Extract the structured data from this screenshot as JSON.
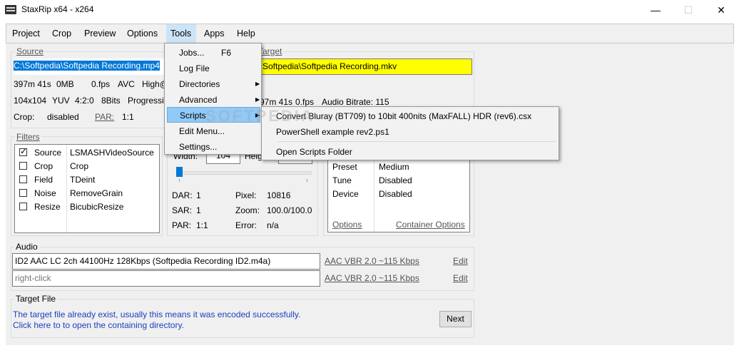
{
  "window": {
    "title": "StaxRip x64 - x264",
    "minimize": "—",
    "maximize": "☐",
    "close": "✕"
  },
  "menu": [
    "Project",
    "Crop",
    "Preview",
    "Options",
    "Tools",
    "Apps",
    "Help"
  ],
  "source": {
    "label": "Source",
    "path": "C:\\Softpedia\\Softpedia Recording.mp4",
    "info_line1": [
      "397m 41s",
      "0MB",
      "0.fps",
      "AVC",
      "High@"
    ],
    "info_line2": [
      "104x104",
      "YUV",
      "4:2:0",
      "8Bits",
      "Progressiv"
    ],
    "crop_label": "Crop:",
    "crop_value": "disabled",
    "par_label": "PAR:",
    "par_value": "1:1"
  },
  "target": {
    "label": "Target",
    "path": "Softpedia\\Softpedia Recording.mkv",
    "info": [
      "97m 41s",
      "0.fps",
      "Audio Bitrate: 115"
    ]
  },
  "filters": {
    "label": "Filters",
    "items": [
      {
        "name": "Source",
        "value": "LSMASHVideoSource",
        "checked": true
      },
      {
        "name": "Crop",
        "value": "Crop",
        "checked": false
      },
      {
        "name": "Field",
        "value": "TDeint",
        "checked": false
      },
      {
        "name": "Noise",
        "value": "RemoveGrain",
        "checked": false
      },
      {
        "name": "Resize",
        "value": "BicubicResize",
        "checked": false
      }
    ]
  },
  "resize": {
    "width_label": "Width:",
    "width_value": "104",
    "height_label": "Heig",
    "slider_value": 0.0,
    "dar_label": "DAR:",
    "dar_value": "1",
    "pixel_label": "Pixel:",
    "pixel_value": "10816",
    "sar_label": "SAR:",
    "sar_value": "1",
    "zoom_label": "Zoom:",
    "zoom_value": "100.0/100.0",
    "par_label": "PAR:",
    "par_value": "1:1",
    "error_label": "Error:",
    "error_value": "n/a"
  },
  "encoder": {
    "rows": [
      {
        "label": "Preset",
        "value": "Medium"
      },
      {
        "label": "Tune",
        "value": "Disabled"
      },
      {
        "label": "Device",
        "value": "Disabled"
      }
    ],
    "options_link": "Options",
    "container_link": "Container Options"
  },
  "audio": {
    "label": "Audio",
    "track1": "ID2 AAC LC 2ch 44100Hz 128Kbps (Softpedia Recording ID2.m4a)",
    "track1_profile": "AAC VBR 2.0 ~115 Kbps",
    "track2": "right-click",
    "track2_profile": "AAC VBR 2.0 ~115 Kbps",
    "edit": "Edit"
  },
  "target_file": {
    "label": "Target File",
    "line1": "The target file already exist, usually this means it was encoded successfully.",
    "line2": "Click here to to open the containing directory.",
    "next": "Next"
  },
  "tools_menu": {
    "jobs": "Jobs...",
    "jobs_shortcut": "F6",
    "log": "Log File",
    "directories": "Directories",
    "advanced": "Advanced",
    "scripts": "Scripts",
    "edit_menu": "Edit Menu...",
    "settings": "Settings..."
  },
  "scripts_menu": {
    "item1": "Convert Bluray (BT709) to 10bit 400nits (MaxFALL) HDR (rev6).csx",
    "item2": "PowerShell example rev2.ps1",
    "item3": "Open Scripts Folder"
  },
  "watermark": "SOFTPEDIA"
}
